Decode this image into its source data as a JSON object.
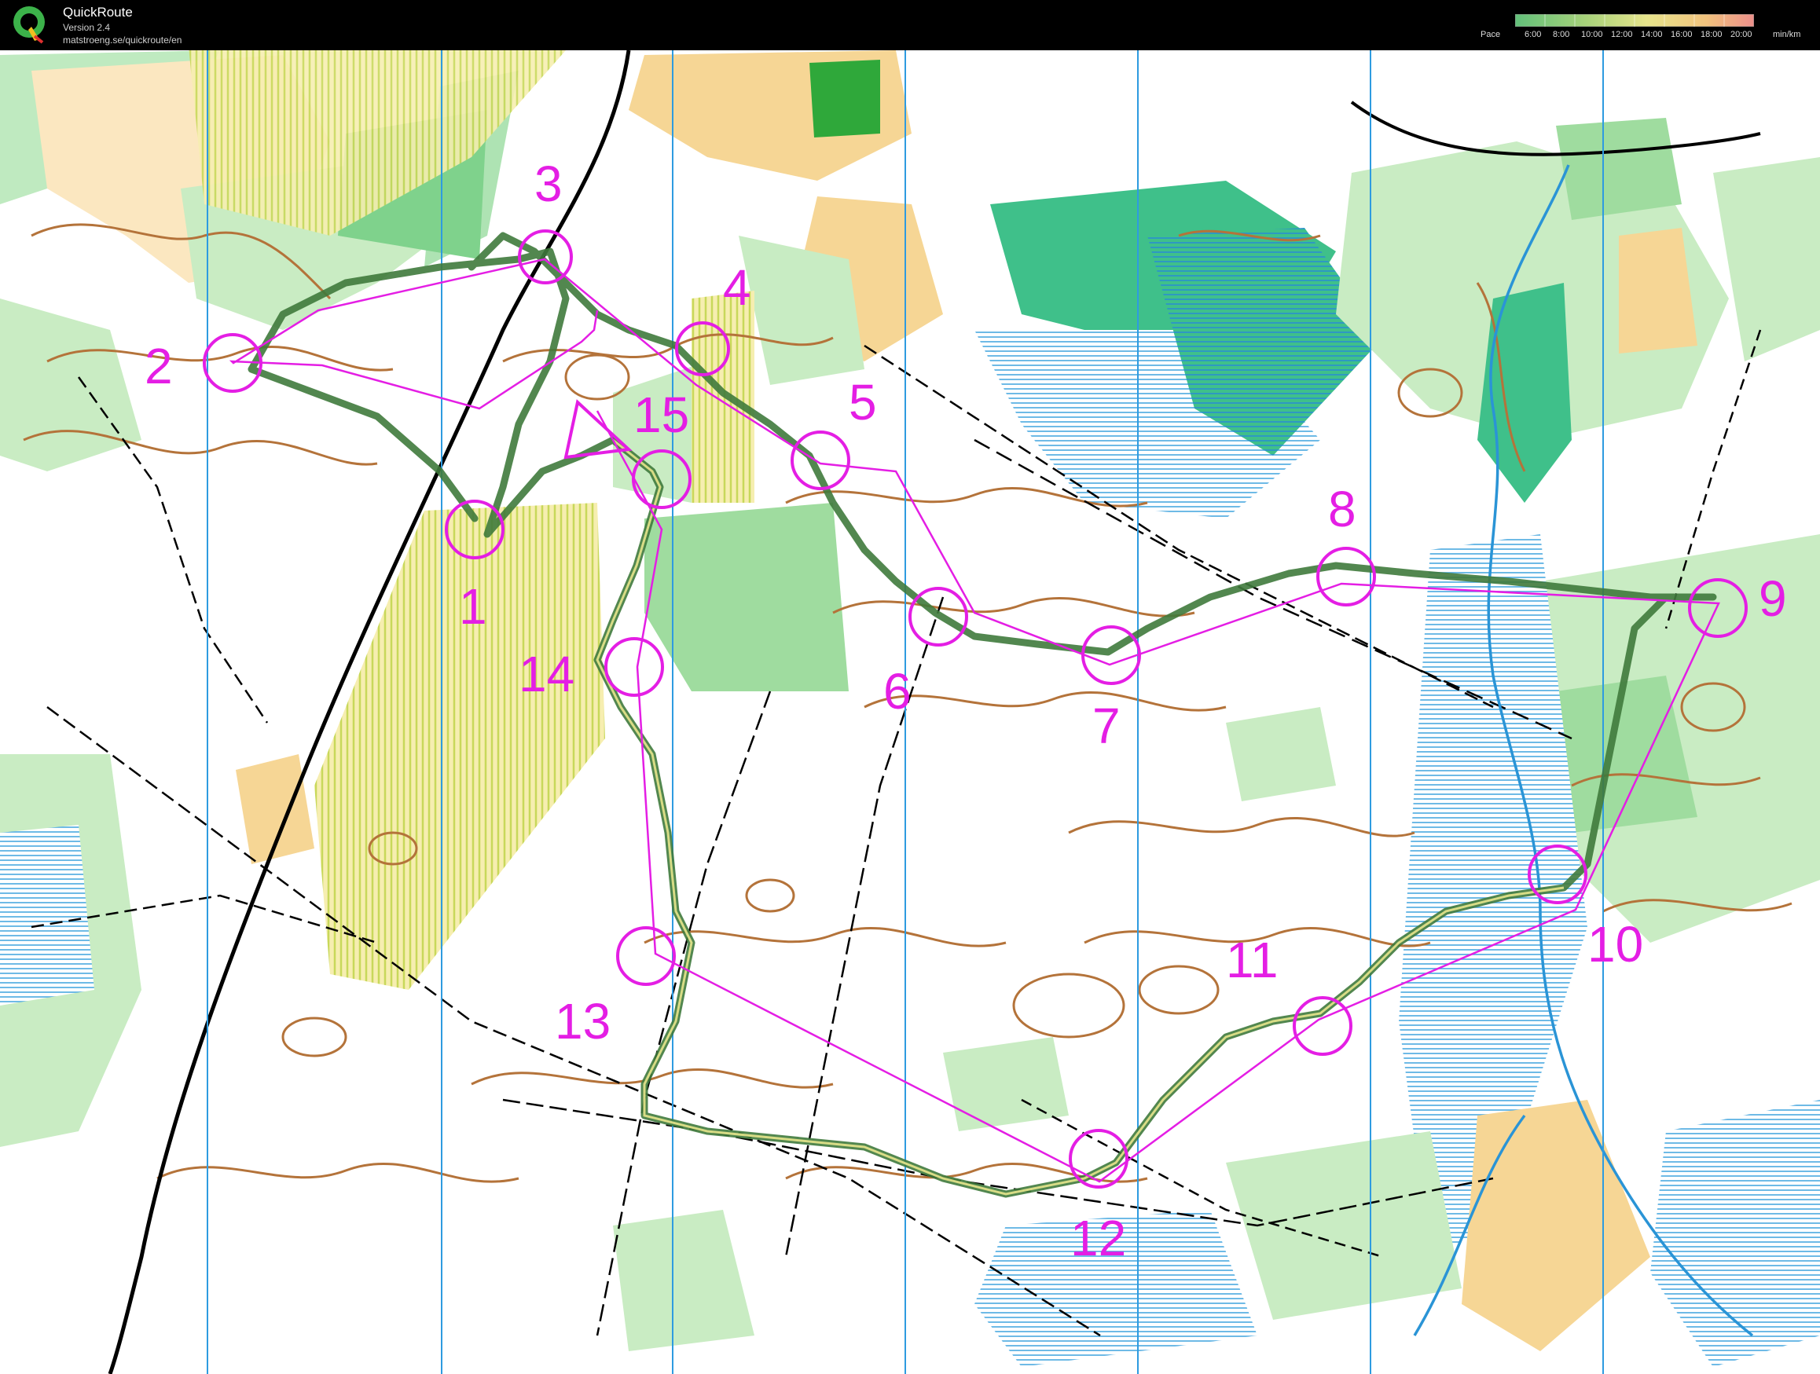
{
  "app": {
    "title": "QuickRoute",
    "version": "Version 2.4",
    "url": "matstroeng.se/quickroute/en"
  },
  "pace_scale": {
    "title": "Pace",
    "unit": "min/km",
    "ticks": [
      "6:00",
      "8:00",
      "10:00",
      "12:00",
      "14:00",
      "16:00",
      "18:00",
      "20:00"
    ],
    "colors": [
      "#62c07a",
      "#a8d27a",
      "#e7e58c",
      "#f1c27d",
      "#ec8f8a"
    ]
  },
  "colors": {
    "course": "#e41ee4",
    "route": "#3f7a3c",
    "forest_green": "#84d78f",
    "dark_green": "#2fb77a",
    "open_yellow": "#f7d9a0",
    "contour": "#b4733a",
    "marsh_blue": "#2aa0d8",
    "magnetic_line": "#2e9be0"
  },
  "controls": [
    {
      "label": "1"
    },
    {
      "label": "2"
    },
    {
      "label": "3"
    },
    {
      "label": "4"
    },
    {
      "label": "5"
    },
    {
      "label": "6"
    },
    {
      "label": "7"
    },
    {
      "label": "8"
    },
    {
      "label": "9"
    },
    {
      "label": "10"
    },
    {
      "label": "11"
    },
    {
      "label": "12"
    },
    {
      "label": "13"
    },
    {
      "label": "14"
    },
    {
      "label": "15"
    }
  ]
}
